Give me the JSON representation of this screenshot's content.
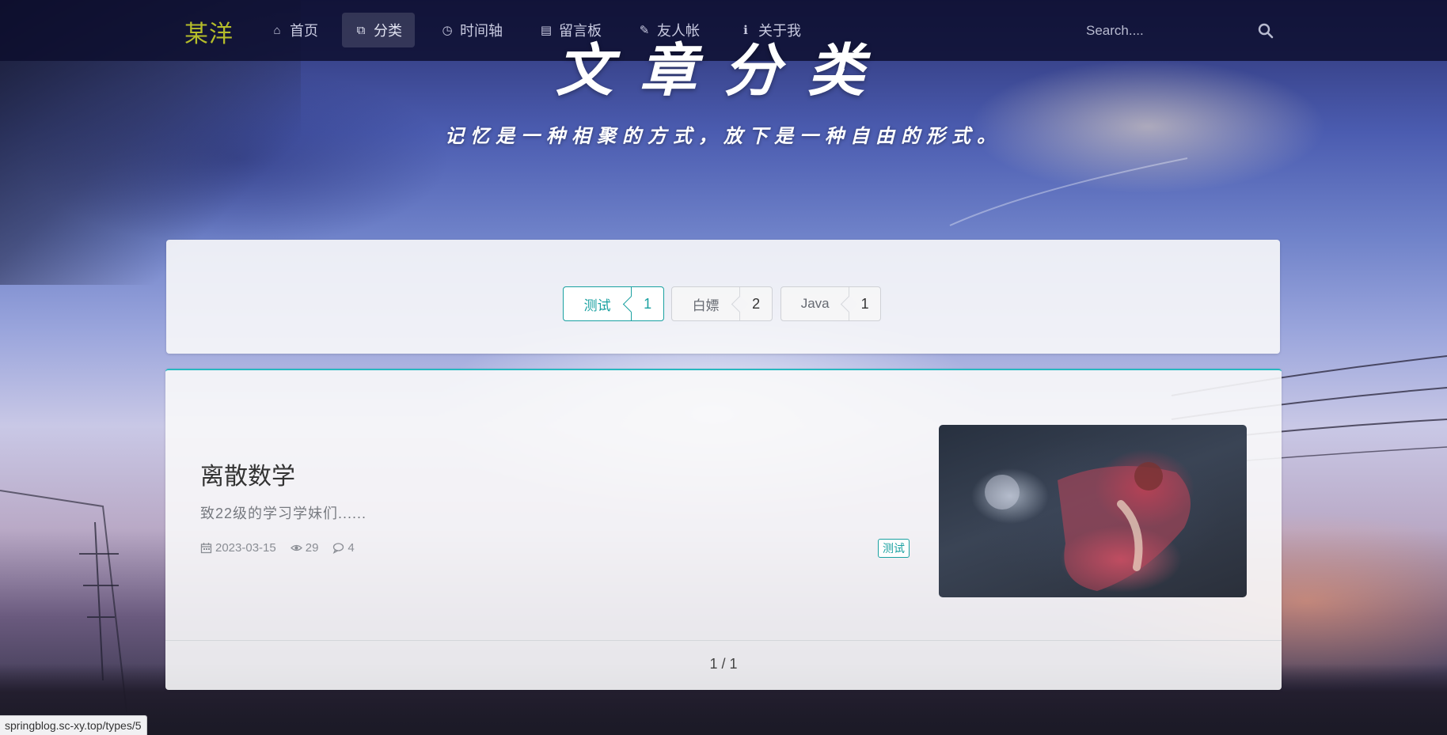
{
  "nav": {
    "brand": "某洋",
    "items": [
      {
        "label": "首页",
        "icon": "home-icon",
        "glyph": "⌂"
      },
      {
        "label": "分类",
        "icon": "clone-icon",
        "glyph": "⧉"
      },
      {
        "label": "时间轴",
        "icon": "clock-icon",
        "glyph": "◷"
      },
      {
        "label": "留言板",
        "icon": "book-icon",
        "glyph": "▤"
      },
      {
        "label": "友人帐",
        "icon": "pencil-icon",
        "glyph": "✎"
      },
      {
        "label": "关于我",
        "icon": "info-icon",
        "glyph": "ℹ"
      }
    ],
    "search_placeholder": "Search...."
  },
  "hero": {
    "title": "文章分类",
    "subtitle": "记忆是一种相聚的方式，放下是一种自由的形式。"
  },
  "categories": [
    {
      "name": "测试",
      "count": "1",
      "active": true
    },
    {
      "name": "白嫖",
      "count": "2",
      "active": false
    },
    {
      "name": "Java",
      "count": "1",
      "active": false
    }
  ],
  "post": {
    "title": "离散数学",
    "excerpt": "致22级的学习学妹们......",
    "date": "2023-03-15",
    "views": "29",
    "comments": "4",
    "tag": "测试"
  },
  "pager": "1 / 1",
  "status_url": "springblog.sc-xy.top/types/5",
  "colors": {
    "accent": "#1aa1a1",
    "brand": "#b5bd2a",
    "navbar": "#0c0e2d"
  }
}
